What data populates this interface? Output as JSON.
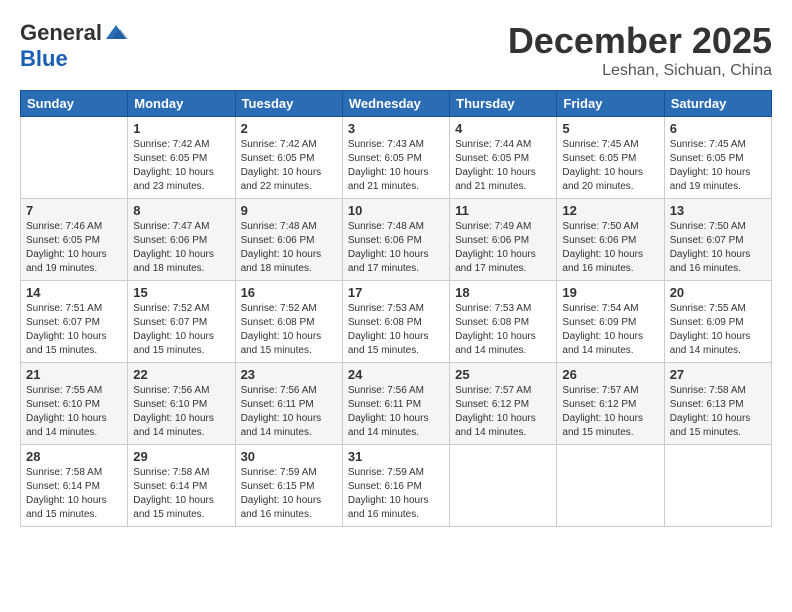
{
  "header": {
    "logo_general": "General",
    "logo_blue": "Blue",
    "month_year": "December 2025",
    "location": "Leshan, Sichuan, China"
  },
  "weekdays": [
    "Sunday",
    "Monday",
    "Tuesday",
    "Wednesday",
    "Thursday",
    "Friday",
    "Saturday"
  ],
  "weeks": [
    [
      {
        "day": "",
        "info": ""
      },
      {
        "day": "1",
        "info": "Sunrise: 7:42 AM\nSunset: 6:05 PM\nDaylight: 10 hours\nand 23 minutes."
      },
      {
        "day": "2",
        "info": "Sunrise: 7:42 AM\nSunset: 6:05 PM\nDaylight: 10 hours\nand 22 minutes."
      },
      {
        "day": "3",
        "info": "Sunrise: 7:43 AM\nSunset: 6:05 PM\nDaylight: 10 hours\nand 21 minutes."
      },
      {
        "day": "4",
        "info": "Sunrise: 7:44 AM\nSunset: 6:05 PM\nDaylight: 10 hours\nand 21 minutes."
      },
      {
        "day": "5",
        "info": "Sunrise: 7:45 AM\nSunset: 6:05 PM\nDaylight: 10 hours\nand 20 minutes."
      },
      {
        "day": "6",
        "info": "Sunrise: 7:45 AM\nSunset: 6:05 PM\nDaylight: 10 hours\nand 19 minutes."
      }
    ],
    [
      {
        "day": "7",
        "info": "Sunrise: 7:46 AM\nSunset: 6:05 PM\nDaylight: 10 hours\nand 19 minutes."
      },
      {
        "day": "8",
        "info": "Sunrise: 7:47 AM\nSunset: 6:06 PM\nDaylight: 10 hours\nand 18 minutes."
      },
      {
        "day": "9",
        "info": "Sunrise: 7:48 AM\nSunset: 6:06 PM\nDaylight: 10 hours\nand 18 minutes."
      },
      {
        "day": "10",
        "info": "Sunrise: 7:48 AM\nSunset: 6:06 PM\nDaylight: 10 hours\nand 17 minutes."
      },
      {
        "day": "11",
        "info": "Sunrise: 7:49 AM\nSunset: 6:06 PM\nDaylight: 10 hours\nand 17 minutes."
      },
      {
        "day": "12",
        "info": "Sunrise: 7:50 AM\nSunset: 6:06 PM\nDaylight: 10 hours\nand 16 minutes."
      },
      {
        "day": "13",
        "info": "Sunrise: 7:50 AM\nSunset: 6:07 PM\nDaylight: 10 hours\nand 16 minutes."
      }
    ],
    [
      {
        "day": "14",
        "info": "Sunrise: 7:51 AM\nSunset: 6:07 PM\nDaylight: 10 hours\nand 15 minutes."
      },
      {
        "day": "15",
        "info": "Sunrise: 7:52 AM\nSunset: 6:07 PM\nDaylight: 10 hours\nand 15 minutes."
      },
      {
        "day": "16",
        "info": "Sunrise: 7:52 AM\nSunset: 6:08 PM\nDaylight: 10 hours\nand 15 minutes."
      },
      {
        "day": "17",
        "info": "Sunrise: 7:53 AM\nSunset: 6:08 PM\nDaylight: 10 hours\nand 15 minutes."
      },
      {
        "day": "18",
        "info": "Sunrise: 7:53 AM\nSunset: 6:08 PM\nDaylight: 10 hours\nand 14 minutes."
      },
      {
        "day": "19",
        "info": "Sunrise: 7:54 AM\nSunset: 6:09 PM\nDaylight: 10 hours\nand 14 minutes."
      },
      {
        "day": "20",
        "info": "Sunrise: 7:55 AM\nSunset: 6:09 PM\nDaylight: 10 hours\nand 14 minutes."
      }
    ],
    [
      {
        "day": "21",
        "info": "Sunrise: 7:55 AM\nSunset: 6:10 PM\nDaylight: 10 hours\nand 14 minutes."
      },
      {
        "day": "22",
        "info": "Sunrise: 7:56 AM\nSunset: 6:10 PM\nDaylight: 10 hours\nand 14 minutes."
      },
      {
        "day": "23",
        "info": "Sunrise: 7:56 AM\nSunset: 6:11 PM\nDaylight: 10 hours\nand 14 minutes."
      },
      {
        "day": "24",
        "info": "Sunrise: 7:56 AM\nSunset: 6:11 PM\nDaylight: 10 hours\nand 14 minutes."
      },
      {
        "day": "25",
        "info": "Sunrise: 7:57 AM\nSunset: 6:12 PM\nDaylight: 10 hours\nand 14 minutes."
      },
      {
        "day": "26",
        "info": "Sunrise: 7:57 AM\nSunset: 6:12 PM\nDaylight: 10 hours\nand 15 minutes."
      },
      {
        "day": "27",
        "info": "Sunrise: 7:58 AM\nSunset: 6:13 PM\nDaylight: 10 hours\nand 15 minutes."
      }
    ],
    [
      {
        "day": "28",
        "info": "Sunrise: 7:58 AM\nSunset: 6:14 PM\nDaylight: 10 hours\nand 15 minutes."
      },
      {
        "day": "29",
        "info": "Sunrise: 7:58 AM\nSunset: 6:14 PM\nDaylight: 10 hours\nand 15 minutes."
      },
      {
        "day": "30",
        "info": "Sunrise: 7:59 AM\nSunset: 6:15 PM\nDaylight: 10 hours\nand 16 minutes."
      },
      {
        "day": "31",
        "info": "Sunrise: 7:59 AM\nSunset: 6:16 PM\nDaylight: 10 hours\nand 16 minutes."
      },
      {
        "day": "",
        "info": ""
      },
      {
        "day": "",
        "info": ""
      },
      {
        "day": "",
        "info": ""
      }
    ]
  ]
}
